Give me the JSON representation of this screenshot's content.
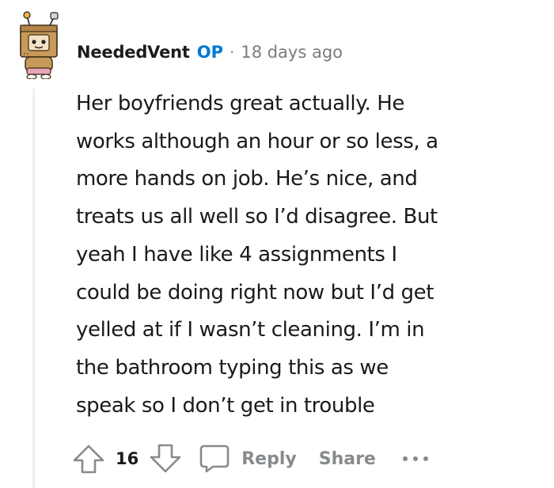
{
  "comment": {
    "author": "NeededVent",
    "op_badge": "OP",
    "separator": "·",
    "timestamp": "18 days ago",
    "body": "Her boyfriends great actually. He works although an hour or so less, a more hands on job. He’s nice, and treats us all well so I’d disagree. But yeah I have like 4 assignments I could be doing right now but I’d get yelled at if I wasn’t cleaning. I’m in the bathroom typing this as we speak so I don’t get in trouble",
    "body_lines": [
      "Her boyfriends great actually. He",
      "works although an hour or so less, a",
      "more hands on job. He’s nice, and",
      "treats us all well so I’d disagree. But",
      "yeah I have like 4 assignments I",
      "could be doing right now but I’d get",
      "yelled at if I wasn’t cleaning. I’m in",
      "the bathroom typing this as we",
      "speak so I don’t get in trouble"
    ]
  },
  "actions": {
    "upvote_icon": "arrow-up-outline-icon",
    "vote_count": "16",
    "downvote_icon": "arrow-down-outline-icon",
    "reply_icon": "speech-bubble-icon",
    "reply_label": "Reply",
    "share_label": "Share",
    "more_icon": "ellipsis-icon"
  },
  "colors": {
    "op_badge": "#0079d3",
    "text": "#1a1a1b",
    "muted": "#878a8c",
    "thread_line": "#edeff1"
  }
}
